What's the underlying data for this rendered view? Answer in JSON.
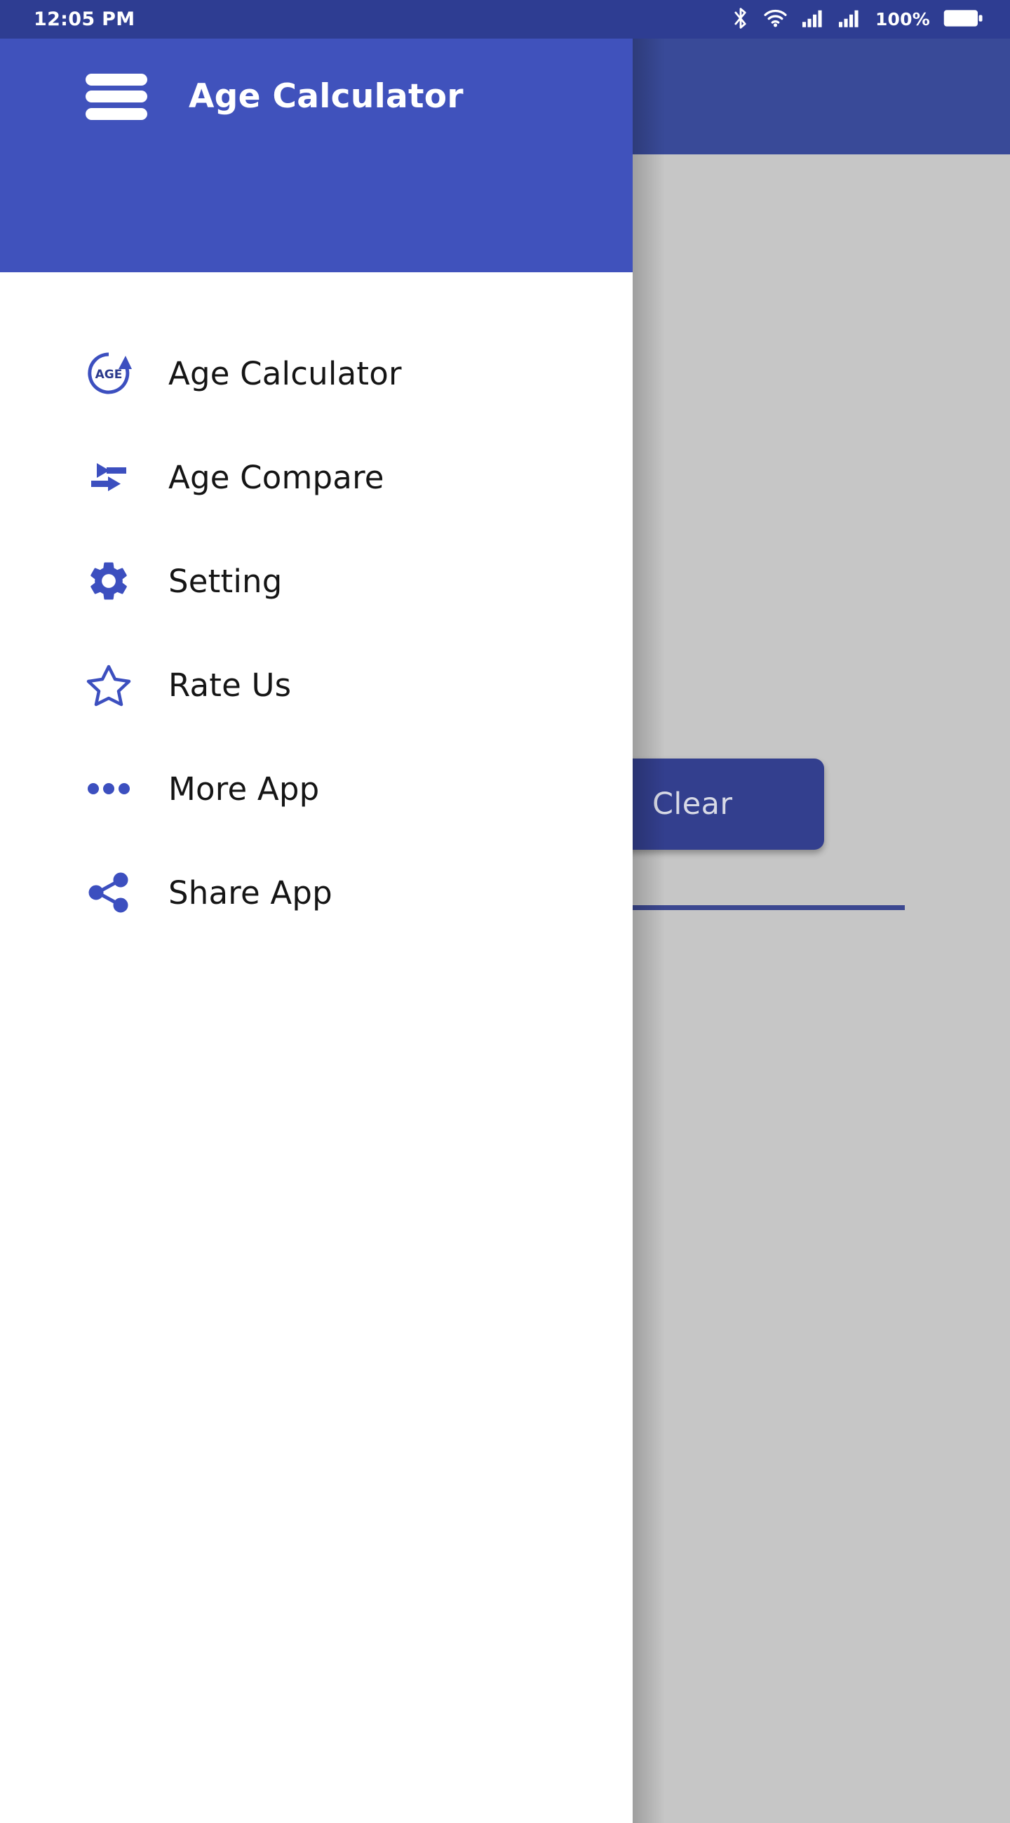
{
  "status_bar": {
    "time": "12:05 PM",
    "battery_percent": "100%",
    "icons": [
      "bluetooth-icon",
      "wifi-icon",
      "signal-1-icon",
      "signal-2-icon",
      "battery-icon"
    ]
  },
  "app_bar": {
    "title": "Age Calculator",
    "menu_icon": "hamburger-menu-icon"
  },
  "drawer": {
    "header_title": "Age Calculator",
    "items": [
      {
        "label": "Age Calculator",
        "icon": "age-circle-icon"
      },
      {
        "label": "Age Compare",
        "icon": "compare-arrows-icon"
      },
      {
        "label": "Setting",
        "icon": "gear-icon"
      },
      {
        "label": "Rate Us",
        "icon": "star-outline-icon"
      },
      {
        "label": "More App",
        "icon": "more-dots-icon"
      },
      {
        "label": "Share App",
        "icon": "share-icon"
      }
    ]
  },
  "main": {
    "clear_button_label": "Clear"
  },
  "colors": {
    "status_bar": "#2E3D92",
    "app_bar": "#394A98",
    "drawer_header": "#4052BC",
    "accent": "#3B4790",
    "icon_blue": "#3C4FBF",
    "scrim": "#C6C6C6",
    "button": "#333F8E"
  }
}
